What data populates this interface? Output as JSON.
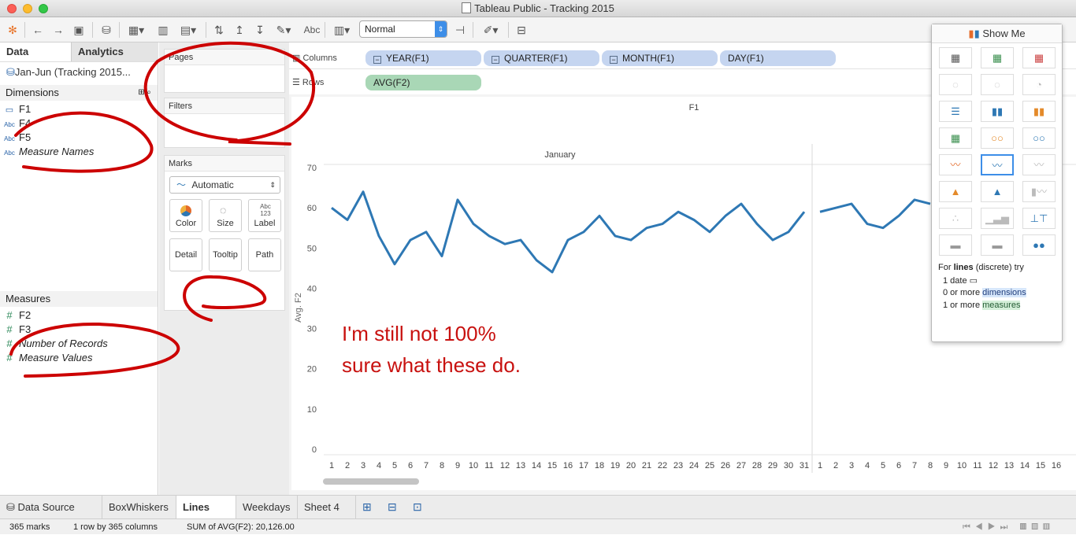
{
  "window": {
    "title": "Tableau Public - Tracking 2015"
  },
  "toolbar": {
    "fit_value": "Normal",
    "abc_label": "Abc"
  },
  "data_pane": {
    "tabs": [
      "Data",
      "Analytics"
    ],
    "datasource": "Jan-Jun (Tracking 2015...",
    "dimensions_header": "Dimensions",
    "dimensions": [
      "F1",
      "F4",
      "F5",
      "Measure Names"
    ],
    "measures_header": "Measures",
    "measures": [
      "F2",
      "F3",
      "Number of Records",
      "Measure Values"
    ]
  },
  "cards": {
    "pages": "Pages",
    "filters": "Filters",
    "marks": "Marks",
    "mark_type": "Automatic",
    "buttons": [
      "Color",
      "Size",
      "Label",
      "Detail",
      "Tooltip",
      "Path"
    ],
    "label_icon": "Abc 123"
  },
  "shelves": {
    "columns_label": "Columns",
    "rows_label": "Rows",
    "columns": [
      "YEAR(F1)",
      "QUARTER(F1)",
      "MONTH(F1)",
      "DAY(F1)"
    ],
    "rows": [
      "AVG(F2)"
    ]
  },
  "annotation": {
    "line1": "I'm still not 100%",
    "line2": "sure what these do."
  },
  "chart_data": {
    "type": "line",
    "title": "F1",
    "panes": [
      "January",
      ""
    ],
    "ylabel": "Avg. F2",
    "ylim": [
      0,
      70
    ],
    "yticks": [
      0,
      10,
      20,
      30,
      40,
      50,
      60,
      70
    ],
    "series": [
      {
        "name": "January",
        "x": [
          1,
          2,
          3,
          4,
          5,
          6,
          7,
          8,
          9,
          10,
          11,
          12,
          13,
          14,
          15,
          16,
          17,
          18,
          19,
          20,
          21,
          22,
          23,
          24,
          25,
          26,
          27,
          28,
          29,
          30,
          31
        ],
        "values": [
          60,
          57,
          64,
          53,
          46,
          52,
          54,
          48,
          62,
          56,
          53,
          51,
          52,
          47,
          44,
          52,
          54,
          58,
          53,
          52,
          55,
          56,
          59,
          57,
          54,
          58,
          61,
          56,
          52,
          54,
          59
        ]
      },
      {
        "name": "",
        "x": [
          1,
          2,
          3,
          4,
          5,
          6,
          7,
          8,
          9,
          10,
          11,
          12,
          13,
          14,
          15,
          16
        ],
        "values": [
          59,
          60,
          61,
          56,
          55,
          58,
          62,
          61,
          null,
          null,
          null,
          null,
          null,
          null,
          null,
          null
        ]
      }
    ],
    "color": "#2e78b4",
    "grid": false
  },
  "show_me": {
    "title": "Show Me",
    "hint_prefix": "For",
    "hint_bold": "lines",
    "hint_suffix": "(discrete) try",
    "req1": "1 date",
    "req2_pre": "0 or more",
    "req2_hl": "dimensions",
    "req3_pre": "1 or more",
    "req3_hl": "measures"
  },
  "sheet_tabs": [
    "Data Source",
    "BoxWhiskers",
    "Lines",
    "Weekdays",
    "Sheet 4"
  ],
  "active_tab": "Lines",
  "status": {
    "marks": "365 marks",
    "layout": "1 row by 365 columns",
    "sum": "SUM of AVG(F2): 20,126.00"
  }
}
